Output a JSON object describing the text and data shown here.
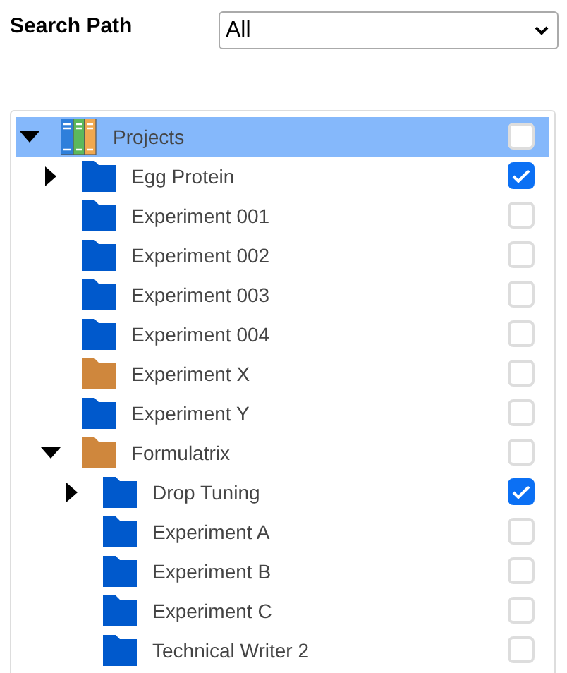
{
  "search_path": {
    "label": "Search Path",
    "value": "All"
  },
  "tree": [
    {
      "label": "Projects",
      "kind": "library",
      "expanded": true,
      "selected": true,
      "checked": false,
      "children": [
        {
          "label": "Egg Protein",
          "kind": "folder",
          "color": "#0059cc",
          "expanded": false,
          "selected": false,
          "checked": true
        },
        {
          "label": "Experiment 001",
          "kind": "folder",
          "color": "#0059cc",
          "selected": false,
          "checked": false
        },
        {
          "label": "Experiment 002",
          "kind": "folder",
          "color": "#0059cc",
          "selected": false,
          "checked": false
        },
        {
          "label": "Experiment 003",
          "kind": "folder",
          "color": "#0059cc",
          "selected": false,
          "checked": false
        },
        {
          "label": "Experiment 004",
          "kind": "folder",
          "color": "#0059cc",
          "selected": false,
          "checked": false
        },
        {
          "label": "Experiment X",
          "kind": "folder",
          "color": "#cf873d",
          "selected": false,
          "checked": false
        },
        {
          "label": "Experiment Y",
          "kind": "folder",
          "color": "#0059cc",
          "selected": false,
          "checked": false
        },
        {
          "label": "Formulatrix",
          "kind": "folder",
          "color": "#cf873d",
          "expanded": true,
          "selected": false,
          "checked": false,
          "children": [
            {
              "label": "Drop Tuning",
              "kind": "folder",
              "color": "#0059cc",
              "expanded": false,
              "selected": false,
              "checked": true
            },
            {
              "label": "Experiment A",
              "kind": "folder",
              "color": "#0059cc",
              "selected": false,
              "checked": false
            },
            {
              "label": "Experiment B",
              "kind": "folder",
              "color": "#0059cc",
              "selected": false,
              "checked": false
            },
            {
              "label": "Experiment C",
              "kind": "folder",
              "color": "#0059cc",
              "selected": false,
              "checked": false
            },
            {
              "label": "Technical Writer 2",
              "kind": "folder",
              "color": "#0059cc",
              "selected": false,
              "checked": false
            }
          ]
        }
      ]
    }
  ]
}
